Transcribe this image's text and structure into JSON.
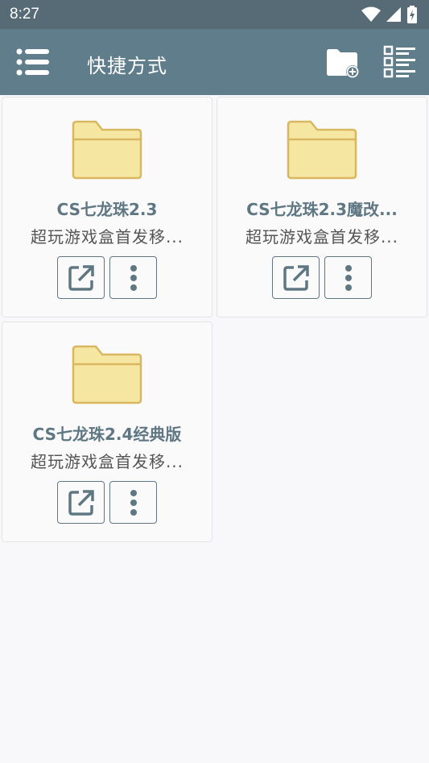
{
  "status_bar": {
    "time": "8:27"
  },
  "toolbar": {
    "title": "快捷方式"
  },
  "shortcuts": [
    {
      "name": "CS七龙珠2.3",
      "desc": "超玩游戏盒首发移..."
    },
    {
      "name": "CS七龙珠2.3魔改...",
      "desc": "超玩游戏盒首发移..."
    },
    {
      "name": "CS七龙珠2.4经典版",
      "desc": "超玩游戏盒首发移..."
    }
  ],
  "colors": {
    "toolbar": "#607d8b",
    "folder_fill": "#f5e6a1",
    "folder_stroke": "#d9b760",
    "accent": "#5f7782"
  },
  "icons": {
    "menu": "menu-icon",
    "new_folder": "new-folder-icon",
    "view": "list-view-icon",
    "open": "open-external-icon",
    "more": "more-vert-icon"
  }
}
